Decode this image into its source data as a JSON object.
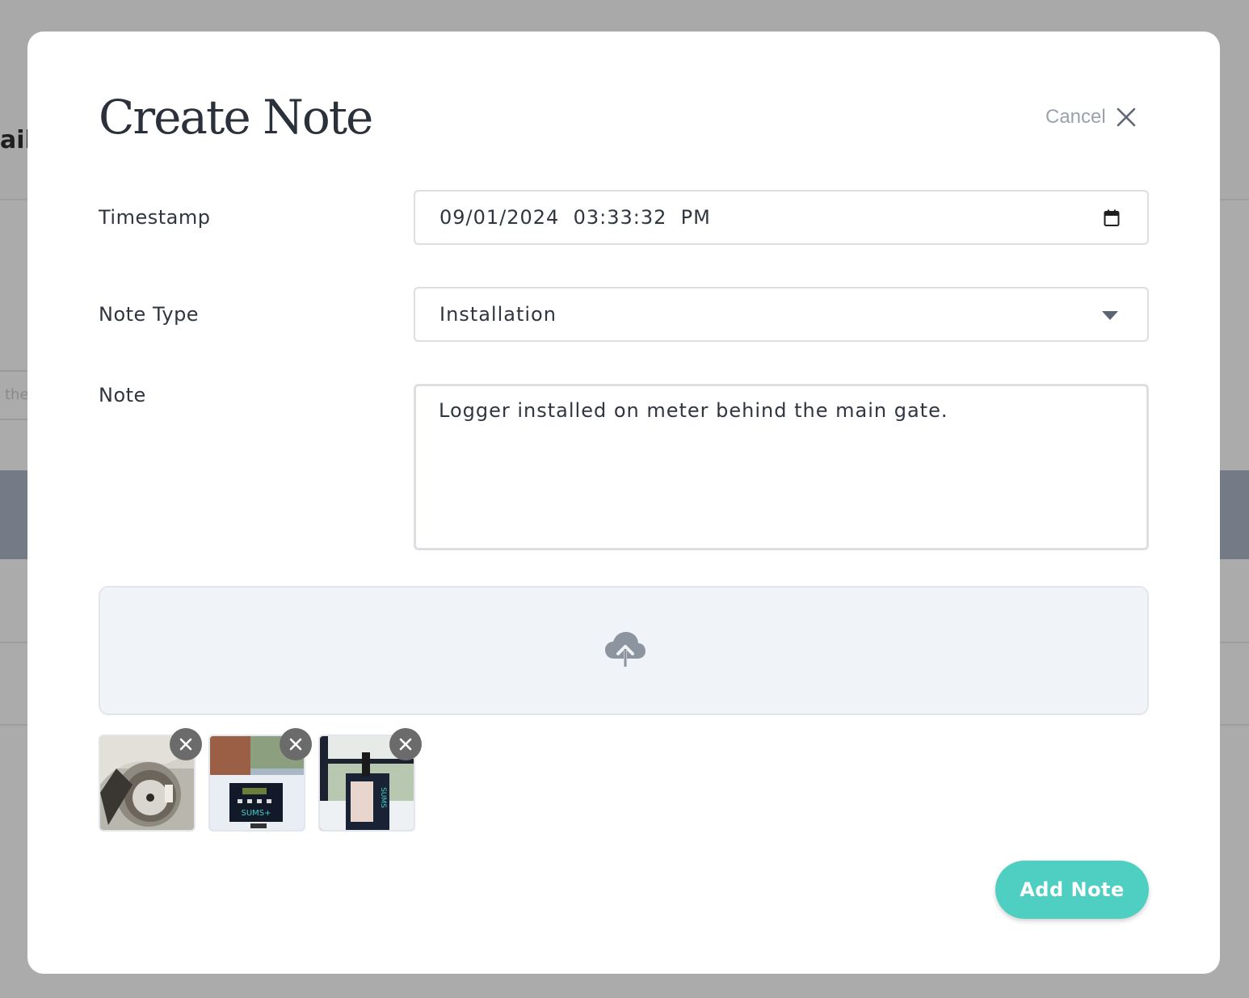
{
  "background": {
    "header_fragment": "ail",
    "search_fragment": "the"
  },
  "modal": {
    "title": "Create Note",
    "cancel_label": "Cancel",
    "cancel_icon": "close-icon"
  },
  "form": {
    "timestamp": {
      "label": "Timestamp",
      "value": "09/01/2024  03:33:32  PM",
      "icon": "calendar-icon"
    },
    "note_type": {
      "label": "Note Type",
      "selected": "Installation",
      "icon": "caret-down-icon"
    },
    "note": {
      "label": "Note",
      "value": "Logger installed on meter behind the main gate."
    },
    "upload": {
      "icon": "cloud-upload-icon"
    }
  },
  "attachments": [
    {
      "subject": "water meter",
      "remove_icon": "close-icon"
    },
    {
      "subject": "SUMS logger box",
      "remove_icon": "close-icon"
    },
    {
      "subject": "SUMS device on railing",
      "remove_icon": "close-icon"
    }
  ],
  "attachment_label_2": "SUMS+",
  "attachment_label_3": "SUMS",
  "actions": {
    "submit_label": "Add Note"
  },
  "colors": {
    "accent": "#4ecfc1",
    "overlay": "#ababab",
    "text": "#2f3640",
    "muted": "#9aa3ad"
  }
}
